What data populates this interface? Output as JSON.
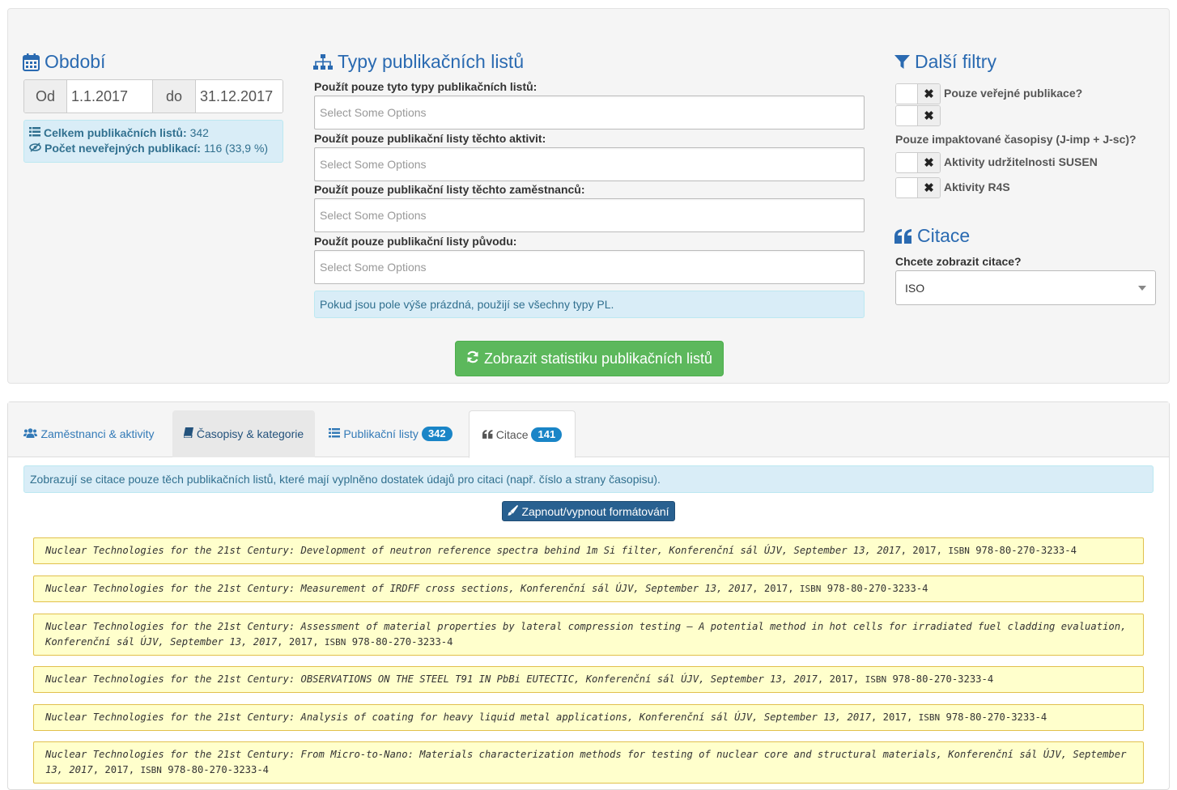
{
  "period": {
    "heading": "Období",
    "from_label": "Od",
    "from_value": "1.1.2017",
    "to_label": "do",
    "to_value": "31.12.2017",
    "stats": {
      "total_label": "Celkem publikačních listů:",
      "total_value": "342",
      "nonpublic_label": "Počet neveřejných publikací:",
      "nonpublic_value": "116 (33,9 %)"
    }
  },
  "types": {
    "heading": "Typy publikačních listů",
    "fields": [
      {
        "label": "Použít pouze tyto typy publikačních listů:",
        "placeholder": "Select Some Options"
      },
      {
        "label": "Použít pouze publikační listy těchto aktivit:",
        "placeholder": "Select Some Options"
      },
      {
        "label": "Použít pouze publikační listy těchto zaměstnanců:",
        "placeholder": "Select Some Options"
      },
      {
        "label": "Použít pouze publikační listy původu:",
        "placeholder": "Select Some Options"
      }
    ],
    "hint": "Pokud jsou pole výše prázdná, použijí se všechny typy PL.",
    "submit_label": "Zobrazit statistiku publikačních listů"
  },
  "filters": {
    "heading": "Další filtry",
    "public_label": "Pouze veřejné publikace?",
    "impact_label": "Pouze impaktované časopisy (J-imp + J-sc)?",
    "susen_label": "Aktivity udržitelnosti SUSEN",
    "r4s_label": "Aktivity R4S",
    "toggle_symbol": "✖"
  },
  "citations": {
    "heading": "Citace",
    "question": "Chcete zobrazit citace?",
    "selected": "ISO"
  },
  "tabs": [
    {
      "label": "Zaměstnanci & aktivity",
      "icon": "users-icon"
    },
    {
      "label": "Časopisy & kategorie",
      "icon": "book-icon"
    },
    {
      "label": "Publikační listy",
      "icon": "list-icon",
      "badge": "342"
    },
    {
      "label": "Citace",
      "icon": "quote-icon",
      "badge": "141"
    }
  ],
  "tab_content": {
    "info": "Zobrazují se citace pouze těch publikačních listů, které mají vyplněno dostatek údajů pro citaci (např. číslo a strany časopisu).",
    "format_button": "Zapnout/vypnout formátování",
    "items": [
      {
        "text": "Nuclear Technologies for the 21st Century: Development of neutron reference spectra behind 1m Si filter, Konferenční sál ÚJV, September 13, 2017",
        "year": "2017",
        "isbn_label": "ISBN",
        "isbn": "978-80-270-3233-4"
      },
      {
        "text": "Nuclear Technologies for the 21st Century: Measurement of IRDFF cross sections, Konferenční sál ÚJV, September 13, 2017",
        "year": "2017",
        "isbn_label": "ISBN",
        "isbn": "978-80-270-3233-4"
      },
      {
        "text": "Nuclear Technologies for the 21st Century: Assessment of material properties by lateral compression testing – A potential method in hot cells for irradiated fuel cladding evaluation, Konferenční sál ÚJV, September 13, 2017",
        "year": "2017",
        "isbn_label": "ISBN",
        "isbn": "978-80-270-3233-4"
      },
      {
        "text": "Nuclear Technologies for the 21st Century: OBSERVATIONS ON THE STEEL T91 IN PbBi EUTECTIC, Konferenční sál ÚJV, September 13, 2017",
        "year": "2017",
        "isbn_label": "ISBN",
        "isbn": "978-80-270-3233-4"
      },
      {
        "text": "Nuclear Technologies for the 21st Century: Analysis of coating for heavy liquid metal applications, Konferenční sál ÚJV, September 13, 2017",
        "year": "2017",
        "isbn_label": "ISBN",
        "isbn": "978-80-270-3233-4"
      },
      {
        "text": "Nuclear Technologies for the 21st Century: From Micro-to-Nano: Materials characterization methods for testing of nuclear core and structural materials, Konferenční sál ÚJV, September 13, 2017",
        "year": "2017",
        "isbn_label": "ISBN",
        "isbn": "978-80-270-3233-4"
      }
    ]
  },
  "colors": {
    "heading_blue": "#2a6ab1",
    "green_button": "#5cb85c",
    "badge_blue": "#1a85c7",
    "citation_bg": "#ffffcc",
    "citation_border": "#e1c04c",
    "info_bg": "#d9edf7"
  }
}
